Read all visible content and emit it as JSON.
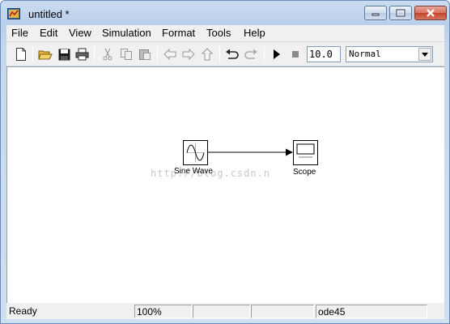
{
  "window": {
    "title": "untitled *"
  },
  "menu": [
    "File",
    "Edit",
    "View",
    "Simulation",
    "Format",
    "Tools",
    "Help"
  ],
  "toolbar": {
    "buttons": [
      "new-model-icon",
      "open-icon",
      "save-icon",
      "print-icon",
      "cut-icon",
      "copy-icon",
      "paste-icon",
      "back-icon",
      "forward-icon",
      "up-icon",
      "undo-icon",
      "redo-icon",
      "start-simulation-icon",
      "stop-simulation-icon"
    ],
    "stop_time": "10.0",
    "simulation_mode": "Normal"
  },
  "canvas": {
    "blocks": {
      "sine_wave": "Sine Wave",
      "scope": "Scope"
    },
    "watermark": "http://blog.csdn.n"
  },
  "status": {
    "ready": "Ready",
    "zoom": "100%",
    "blank1": "",
    "blank2": "",
    "solver": "ode45"
  }
}
